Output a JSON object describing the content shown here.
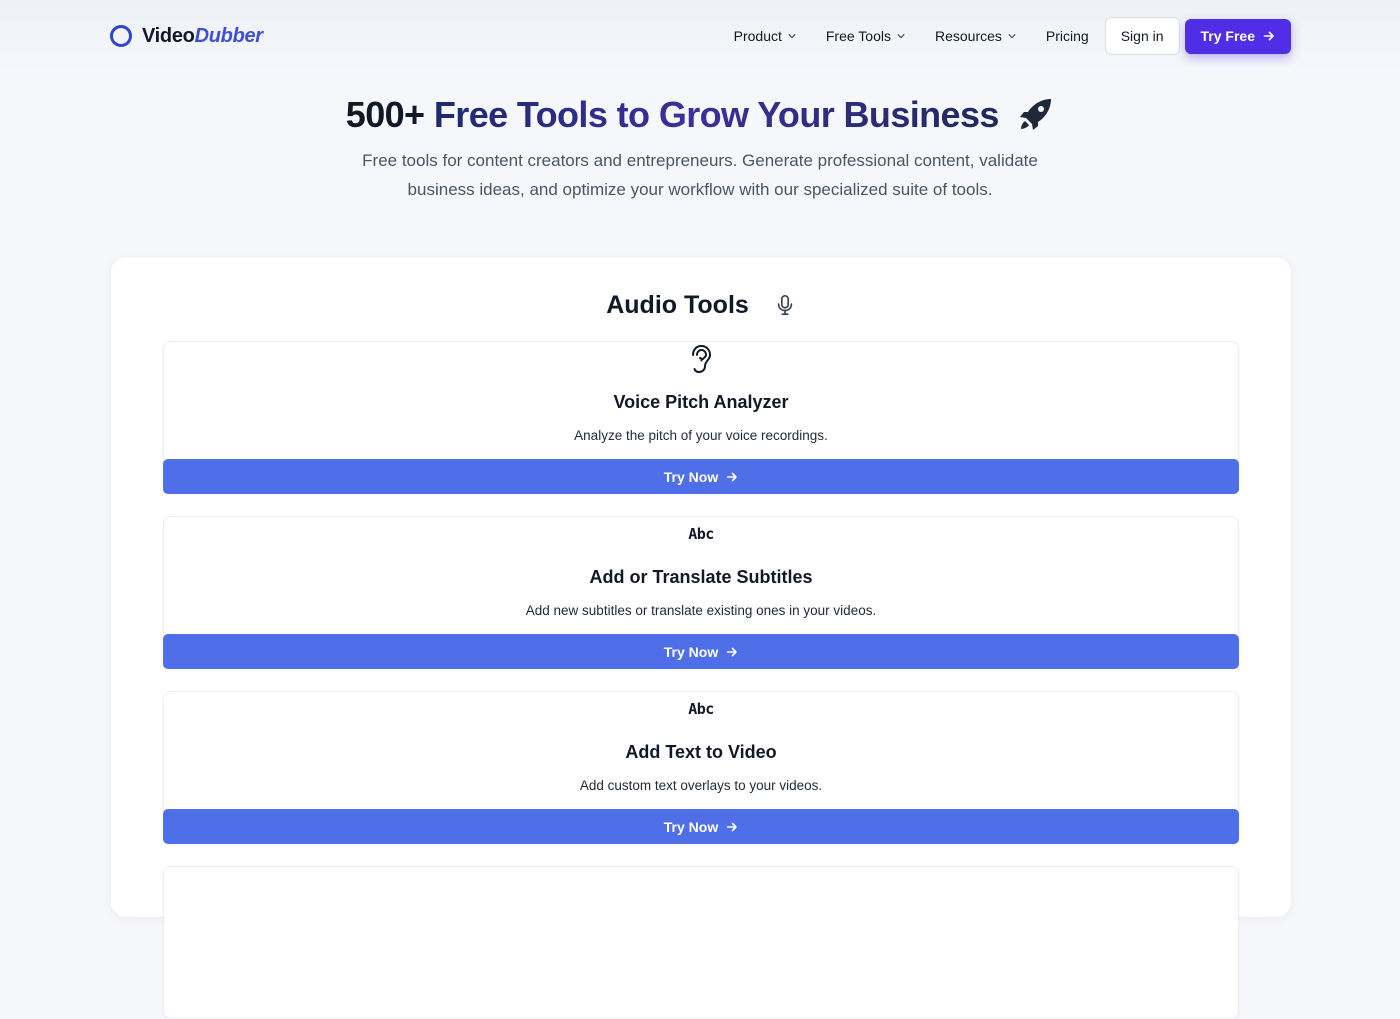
{
  "brand": {
    "name_part1": "Video",
    "name_part2": "Dubber"
  },
  "nav": {
    "items": [
      {
        "label": "Product",
        "has_dropdown": true
      },
      {
        "label": "Free Tools",
        "has_dropdown": true
      },
      {
        "label": "Resources",
        "has_dropdown": true
      },
      {
        "label": "Pricing",
        "has_dropdown": false
      }
    ],
    "signin_label": "Sign in",
    "tryfree_label": "Try Free"
  },
  "hero": {
    "title_part1": "500+",
    "title_part2": "Free Tools to Grow Your Business",
    "subtitle": "Free tools for content creators and entrepreneurs. Generate professional content, validate business ideas, and optimize your workflow with our specialized suite of tools."
  },
  "section": {
    "title": "Audio Tools",
    "title_icon": "microphone-icon",
    "cards": [
      {
        "icon": "ear-icon",
        "title": "Voice Pitch Analyzer",
        "description": "Analyze the pitch of your voice recordings.",
        "button": "Try Now"
      },
      {
        "icon": "abc-text-icon",
        "icon_text": "Abc",
        "title": "Add or Translate Subtitles",
        "description": "Add new subtitles or translate existing ones in your videos.",
        "button": "Try Now"
      },
      {
        "icon": "abc-text-icon",
        "icon_text": "Abc",
        "title": "Add Text to Video",
        "description": "Add custom text overlays to your videos.",
        "button": "Try Now"
      }
    ]
  },
  "colors": {
    "primary_button": "#4f2ee6",
    "card_button": "#4f6fe8",
    "logo_accent": "#3d4fd6",
    "background": "#f5f7fb"
  }
}
